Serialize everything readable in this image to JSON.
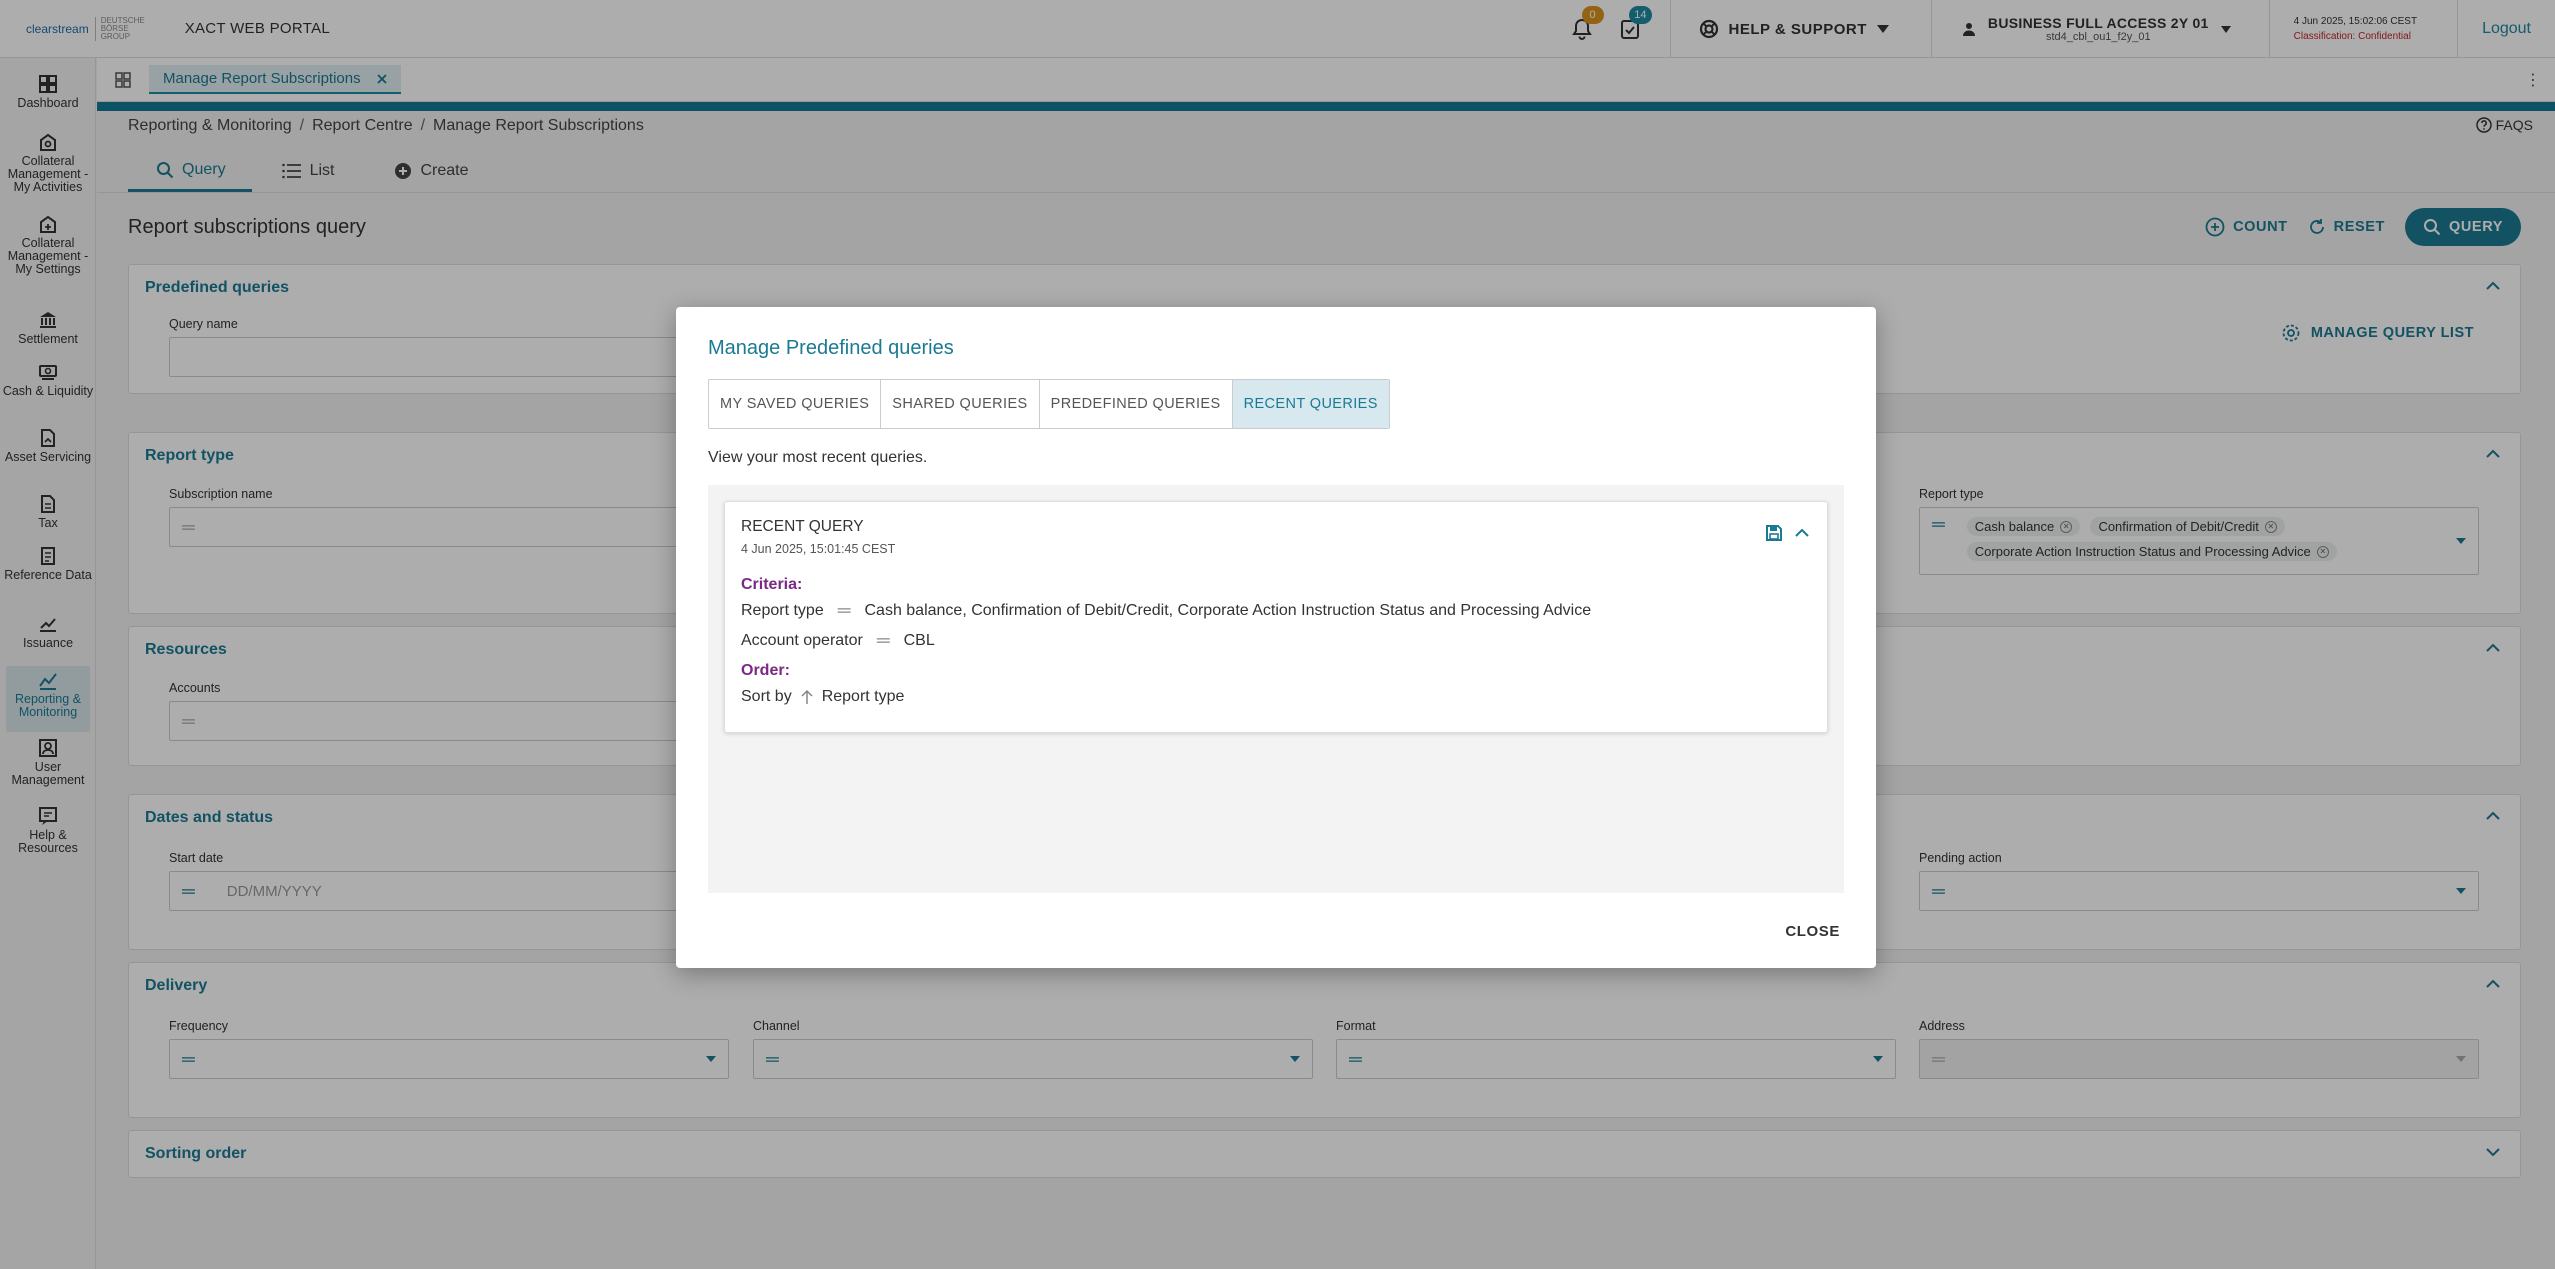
{
  "header": {
    "logo_text": "clearstream",
    "logo_sub": "DEUTSCHE BÖRSE GROUP",
    "portal_name": "XACT WEB PORTAL",
    "notifications_count": "0",
    "tasks_count": "14",
    "help_label": "HELP & SUPPORT",
    "user_role": "BUSINESS FULL ACCESS 2Y 01",
    "user_id": "std4_cbl_ou1_f2y_01",
    "datetime": "4 Jun 2025, 15:02:06 CEST",
    "classification": "Classification: Confidential",
    "logout_label": "Logout"
  },
  "nav": {
    "items": [
      {
        "label": "Dashboard",
        "icon": "dashboard-icon"
      },
      {
        "label": "Collateral Management - My Activities",
        "icon": "collateral-icon"
      },
      {
        "label": "Collateral Management - My Settings",
        "icon": "collateral-settings-icon"
      },
      {
        "label": "Settlement",
        "icon": "bank-icon"
      },
      {
        "label": "Cash & Liquidity",
        "icon": "cash-icon"
      },
      {
        "label": "Asset Servicing",
        "icon": "asset-icon"
      },
      {
        "label": "Tax",
        "icon": "tax-icon"
      },
      {
        "label": "Reference Data",
        "icon": "reference-icon"
      },
      {
        "label": "Issuance",
        "icon": "issuance-icon"
      },
      {
        "label": "Reporting & Monitoring",
        "icon": "reporting-icon"
      },
      {
        "label": "User Management",
        "icon": "users-icon"
      },
      {
        "label": "Help & Resources",
        "icon": "help-icon"
      }
    ]
  },
  "page": {
    "tab_label": "Manage Report Subscriptions",
    "breadcrumb": [
      "Reporting & Monitoring",
      "Report Centre",
      "Manage Report Subscriptions"
    ],
    "faqs_label": "FAQS",
    "subtabs": [
      "Query",
      "List",
      "Create"
    ],
    "title": "Report subscriptions query",
    "actions": {
      "count": "COUNT",
      "reset": "RESET",
      "query": "QUERY"
    }
  },
  "panels": {
    "predefined": {
      "title": "Predefined queries",
      "query_name_label": "Query name",
      "manage_label": "MANAGE QUERY LIST"
    },
    "report_type": {
      "title": "Report type",
      "subscription_name_label": "Subscription name",
      "report_type_label": "Report type",
      "chips": [
        "Cash balance",
        "Confirmation of Debit/Credit",
        "Corporate Action Instruction Status and Processing Advice"
      ]
    },
    "resources": {
      "title": "Resources",
      "accounts_label": "Accounts"
    },
    "dates": {
      "title": "Dates and status",
      "start_date_label": "Start date",
      "start_date_placeholder": "DD/MM/YYYY",
      "pending_action_label": "Pending action"
    },
    "delivery": {
      "title": "Delivery",
      "frequency_label": "Frequency",
      "channel_label": "Channel",
      "format_label": "Format",
      "address_label": "Address"
    },
    "sorting": {
      "title": "Sorting order"
    }
  },
  "modal": {
    "title": "Manage Predefined queries",
    "tabs": [
      "MY SAVED QUERIES",
      "SHARED QUERIES",
      "PREDEFINED QUERIES",
      "RECENT QUERIES"
    ],
    "active_tab": "RECENT QUERIES",
    "description": "View your most recent queries.",
    "query": {
      "title": "RECENT QUERY",
      "date": "4 Jun 2025, 15:01:45 CEST",
      "criteria_label": "Criteria:",
      "criteria": [
        {
          "field": "Report type",
          "value": "Cash balance, Confirmation of Debit/Credit, Corporate Action Instruction Status and Processing Advice"
        },
        {
          "field": "Account operator",
          "value": "CBL"
        }
      ],
      "order_label": "Order:",
      "sort_label": "Sort by",
      "sort_value": "Report type"
    },
    "close_label": "CLOSE"
  }
}
